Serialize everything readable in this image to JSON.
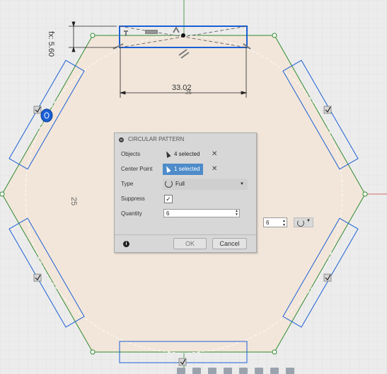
{
  "canvas": {
    "dimension_horizontal": "33.02",
    "dimension_vertical": "5.60",
    "dimension_vertical_prefix": "fx:",
    "dimension_radius": "25",
    "dimension_small": "25"
  },
  "dialog": {
    "title": "CIRCULAR PATTERN",
    "rows": {
      "objects": {
        "label": "Objects",
        "value": "4 selected"
      },
      "center_point": {
        "label": "Center Point",
        "value": "1 selected"
      },
      "type": {
        "label": "Type",
        "value": "Full"
      },
      "suppress": {
        "label": "Suppress",
        "checked_glyph": "✓"
      },
      "quantity": {
        "label": "Quantity",
        "value": "6"
      }
    },
    "clear_glyph": "✕",
    "info_glyph": "i",
    "ok_label": "OK",
    "cancel_label": "Cancel"
  },
  "mini_toolbar": {
    "quantity": "6"
  },
  "colors": {
    "selection_blue": "#2255cc",
    "sketch_fill": "#f2e6da",
    "construction_green": "#2f8a2f",
    "axis_red": "#d04848",
    "dialog_bg": "#d7d7d7",
    "selected_chip": "#4e8bc9"
  }
}
